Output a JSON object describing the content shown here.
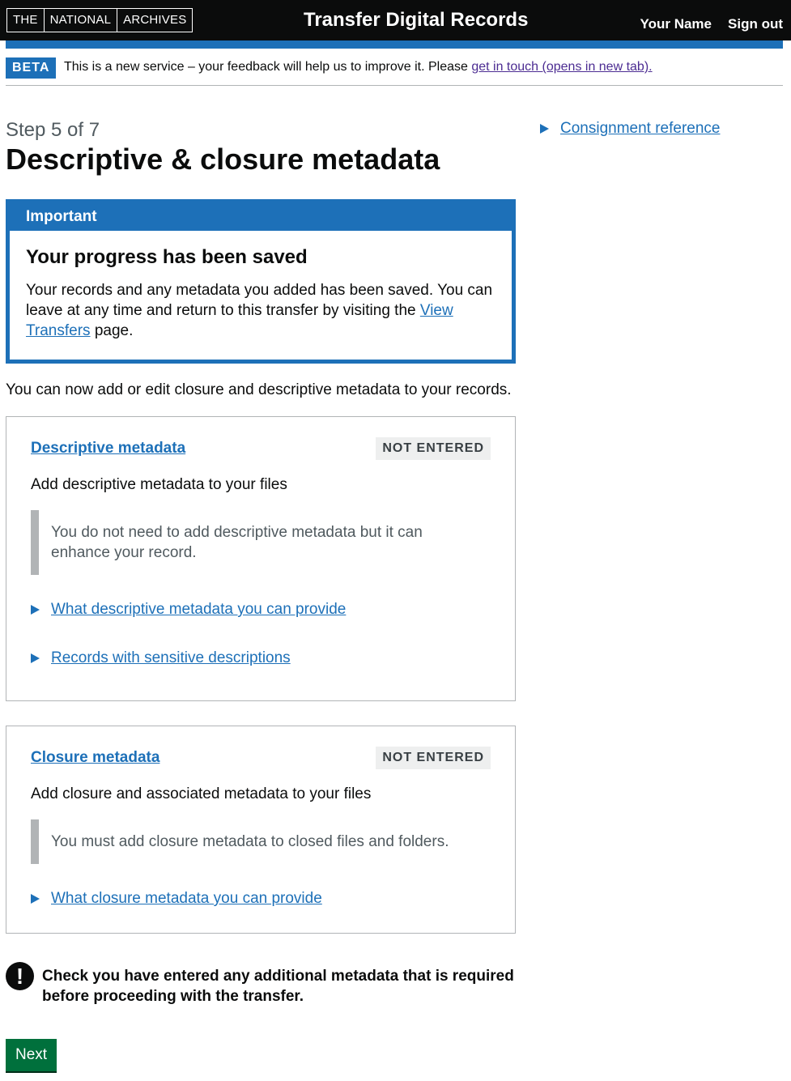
{
  "header": {
    "logo": [
      "THE",
      "NATIONAL",
      "ARCHIVES"
    ],
    "service_name": "Transfer Digital Records",
    "nav": {
      "user_name": "Your Name",
      "sign_out": "Sign out"
    }
  },
  "phase_banner": {
    "tag": "BETA",
    "text": "This is a new service – your feedback will help us to improve it. Please ",
    "link": "get in touch (opens in new tab)."
  },
  "main": {
    "caption": "Step 5 of 7",
    "title": "Descriptive & closure metadata",
    "notification": {
      "header": "Important",
      "heading": "Your progress has been saved",
      "text_before": "Your records and any metadata you added has been saved. You can leave at any time and return to this transfer by visiting the ",
      "link": "View Transfers",
      "text_after": " page."
    },
    "intro": "You can now add or edit closure and descriptive metadata to your records.",
    "cards": [
      {
        "title": "Descriptive metadata",
        "status": "NOT ENTERED",
        "description": "Add descriptive metadata to your files",
        "inset": "You do not need to add descriptive metadata but it can enhance your record.",
        "details": [
          "What descriptive metadata you can provide",
          "Records with sensitive descriptions"
        ]
      },
      {
        "title": "Closure metadata",
        "status": "NOT ENTERED",
        "description": "Add closure and associated metadata to your files",
        "inset": "You must add closure metadata to closed files and folders.",
        "details": [
          "What closure metadata you can provide"
        ]
      }
    ],
    "warning": {
      "icon": "!",
      "text": "Check you have entered any additional metadata that is required before proceeding with the transfer."
    },
    "next_button": "Next"
  },
  "sidebar": {
    "details": "Consignment reference"
  },
  "colors": {
    "header_bg": "#0b0c0c",
    "brand_blue": "#1d70b8",
    "link_visited": "#4c2c92",
    "button_green": "#00703c",
    "tag_grey_bg": "#eeefef"
  }
}
